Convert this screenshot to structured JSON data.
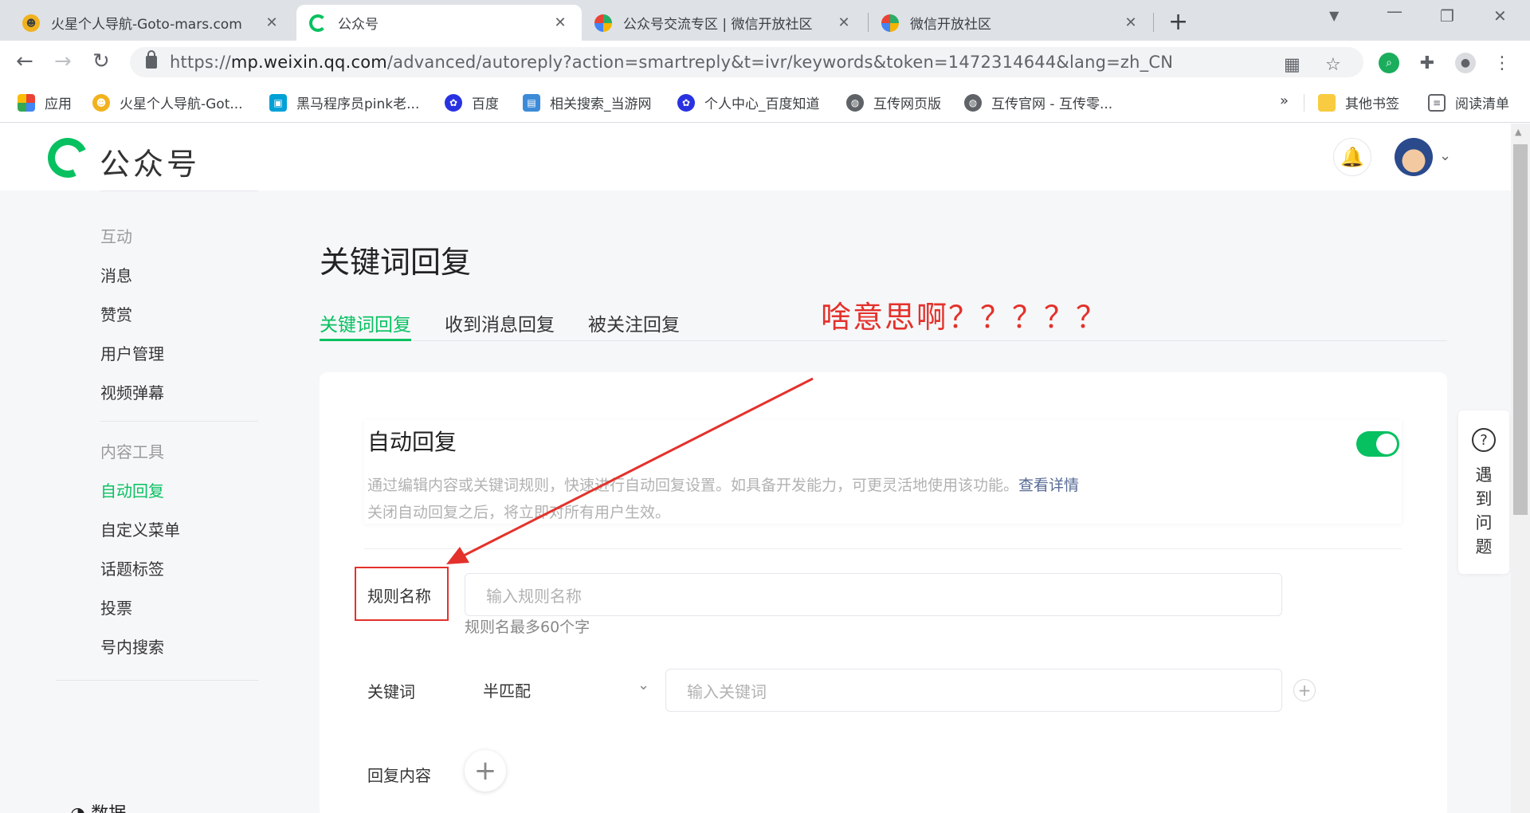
{
  "browser": {
    "tabs": [
      {
        "title": "火星个人导航-Goto-mars.com",
        "active": false
      },
      {
        "title": "公众号",
        "active": true
      },
      {
        "title": "公众号交流专区 | 微信开放社区",
        "active": false
      },
      {
        "title": "微信开放社区",
        "active": false
      }
    ],
    "url_prefix": "https://",
    "url_host": "mp.weixin.qq.com",
    "url_path": "/advanced/autoreply?action=smartreply&t=ivr/keywords&token=1472314644&lang=zh_CN",
    "bookmarks": [
      "应用",
      "火星个人导航-Got...",
      "黑马程序员pink老...",
      "百度",
      "相关搜索_当游网",
      "个人中心_百度知道",
      "互传网页版",
      "互传官网 - 互传零..."
    ],
    "bookmarks_overflow": "»",
    "other_bookmarks": "其他书签",
    "reading_list": "阅读清单"
  },
  "header": {
    "logo_text": "公众号"
  },
  "sidebar": {
    "groups": [
      {
        "label": "互动",
        "items": [
          "消息",
          "赞赏",
          "用户管理",
          "视频弹幕"
        ]
      },
      {
        "label": "内容工具",
        "items": [
          "自动回复",
          "自定义菜单",
          "话题标签",
          "投票",
          "号内搜索"
        ]
      }
    ],
    "active_item": "自动回复",
    "bottom_label": "数据"
  },
  "main": {
    "title": "关键词回复",
    "tabs": [
      "关键词回复",
      "收到消息回复",
      "被关注回复"
    ],
    "active_tab": "关键词回复",
    "annotation": "啥意思啊？？？？？",
    "autoreply": {
      "title": "自动回复",
      "enabled": true,
      "desc1": "通过编辑内容或关键词规则，快速进行自动回复设置。如具备开发能力，可更灵活地使用该功能。",
      "desc_link": "查看详情",
      "desc2": "关闭自动回复之后，将立即对所有用户生效。"
    },
    "form": {
      "rule_name_label": "规则名称",
      "rule_name_placeholder": "输入规则名称",
      "rule_name_hint": "规则名最多60个字",
      "keyword_label": "关键词",
      "match_mode": "半匹配",
      "keyword_placeholder": "输入关键词",
      "reply_label": "回复内容"
    }
  },
  "help": {
    "text": "遇到问题"
  },
  "colors": {
    "brand_green": "#07c160",
    "annotation_red": "#e4312b",
    "link_blue": "#576b95"
  }
}
